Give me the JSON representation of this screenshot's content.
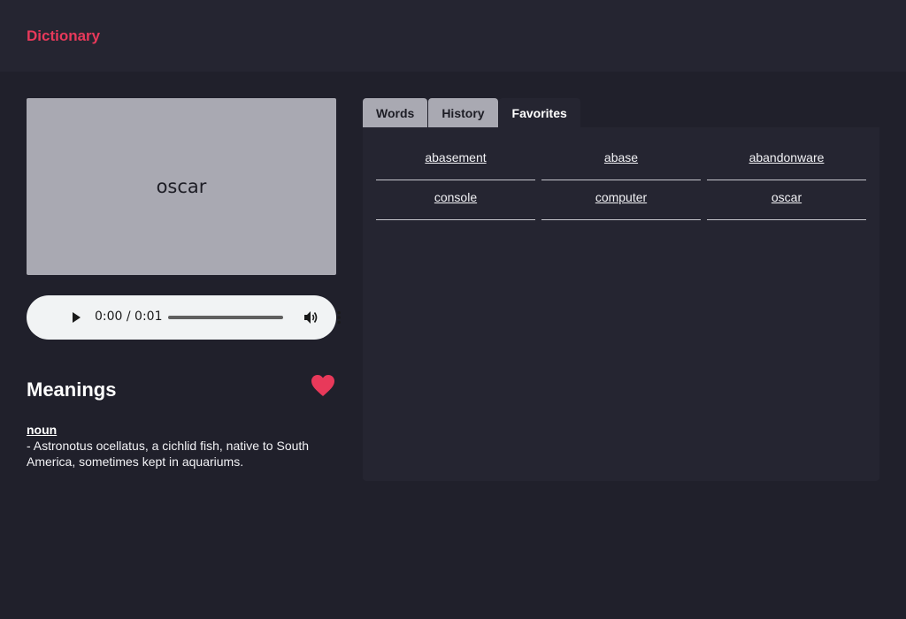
{
  "header": {
    "brand": "Dictionary",
    "brand_color": "#e8395a"
  },
  "word_card": {
    "word": "oscar"
  },
  "audio": {
    "time": "0:00 / 0:01",
    "progress": 0
  },
  "meanings": {
    "title": "Meanings",
    "favorite_icon": "heart-icon",
    "favorite_color": "#e8395a",
    "part_of_speech": "noun",
    "definition": "- Astronotus ocellatus, a cichlid fish, native to South America, sometimes kept in aquariums."
  },
  "tabs": [
    {
      "label": "Words",
      "active": false
    },
    {
      "label": "History",
      "active": false
    },
    {
      "label": "Favorites",
      "active": true
    }
  ],
  "favorites": [
    "abasement",
    "abase",
    "abandonware",
    "console",
    "computer",
    "oscar"
  ]
}
